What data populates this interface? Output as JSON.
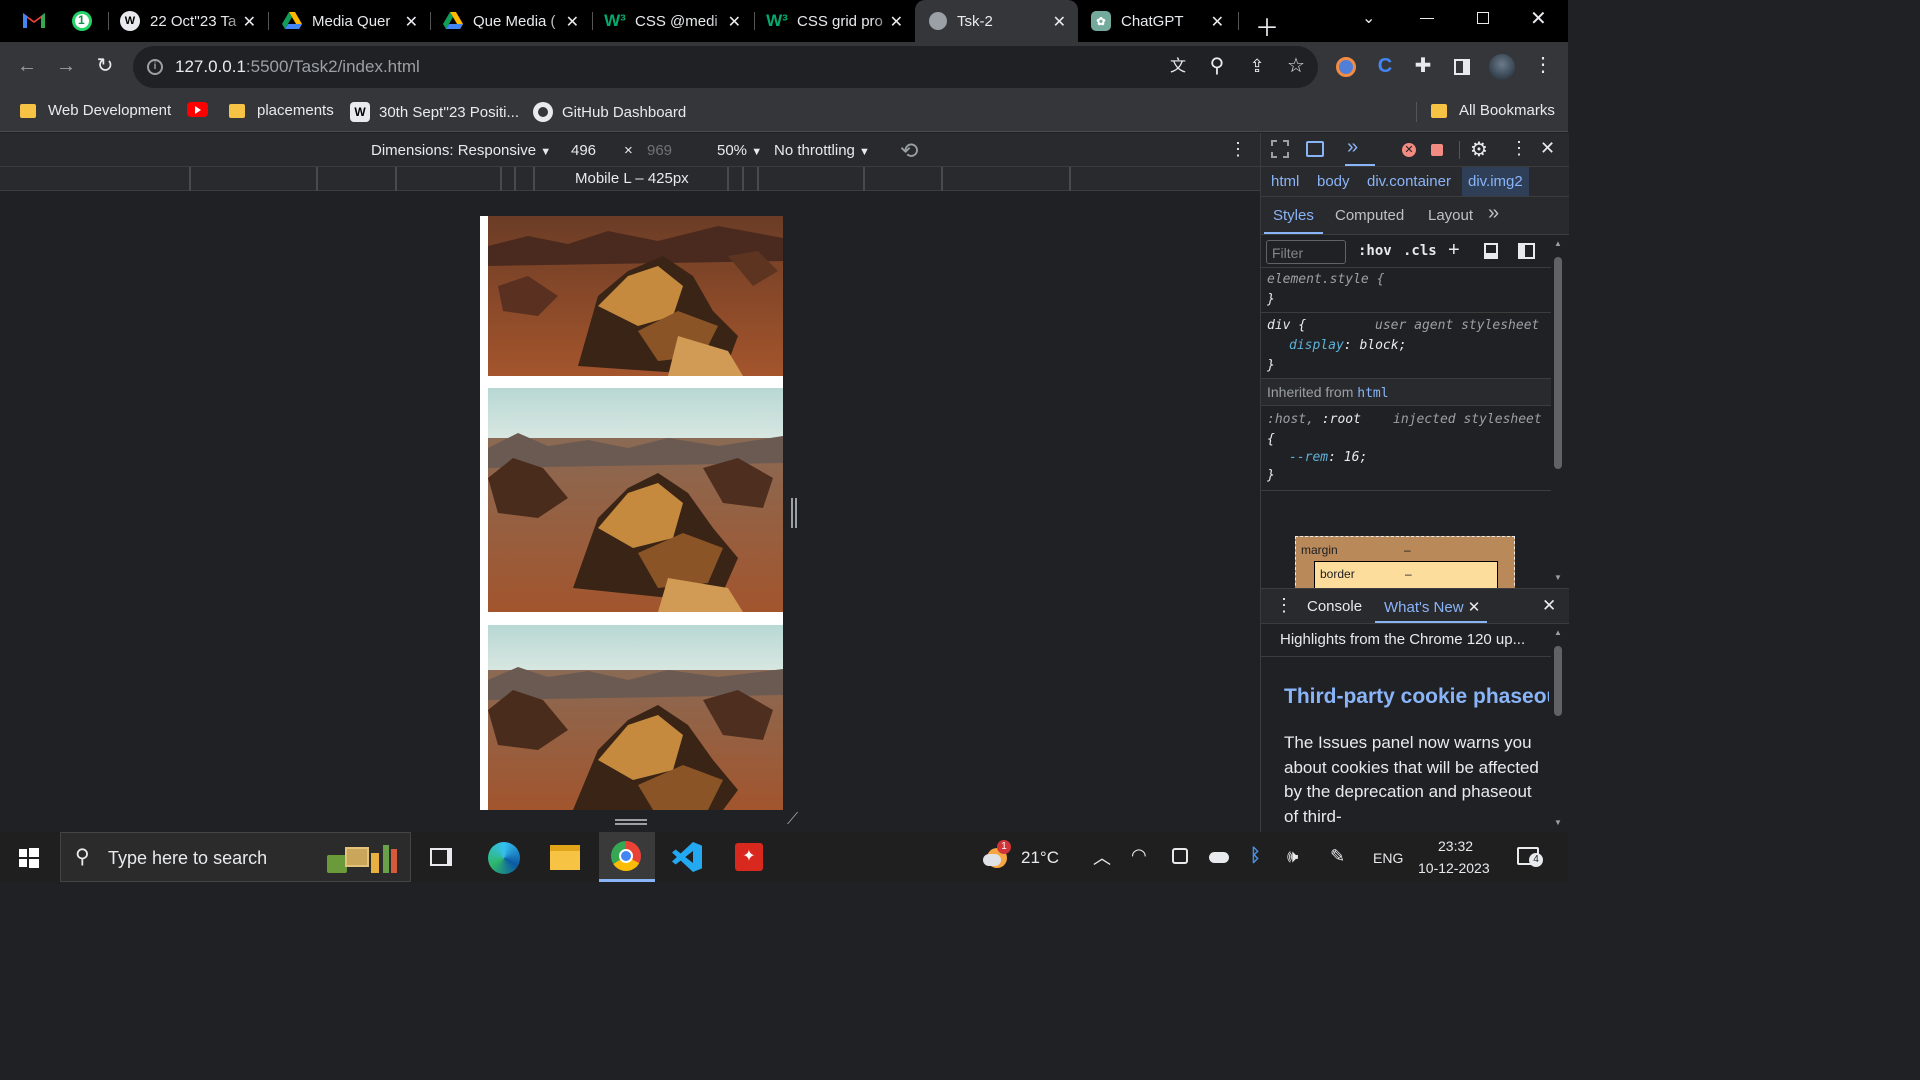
{
  "tabs": [
    {
      "title": "22 Oct''23 Ta",
      "icon": "wordpress-icon",
      "active": false
    },
    {
      "title": "Media Quer",
      "icon": "google-drive-icon",
      "active": false
    },
    {
      "title": "Que Media (",
      "icon": "google-drive-icon",
      "active": false
    },
    {
      "title": "CSS @medi",
      "icon": "w3schools-icon",
      "active": false
    },
    {
      "title": "CSS grid pro",
      "icon": "w3schools-icon",
      "active": false
    },
    {
      "title": "Tsk-2",
      "icon": "globe-icon",
      "active": true
    },
    {
      "title": "ChatGPT",
      "icon": "chatgpt-icon",
      "active": false
    }
  ],
  "pinned": [
    {
      "icon": "gmail-icon"
    },
    {
      "icon": "whatsapp-icon",
      "badge": "1"
    }
  ],
  "address": {
    "host": "127.0.0.1",
    "path": ":5500/Task2/index.html"
  },
  "bookmarks": [
    {
      "label": "Web Development",
      "icon": "folder-icon"
    },
    {
      "label": "",
      "icon": "youtube-icon"
    },
    {
      "label": "placements",
      "icon": "folder-icon"
    },
    {
      "label": "30th Sept''23 Positi...",
      "icon": "wordpress-icon"
    },
    {
      "label": "GitHub Dashboard",
      "icon": "github-icon"
    }
  ],
  "all_bookmarks": "All Bookmarks",
  "device_toolbar": {
    "dimensions": "Dimensions: Responsive",
    "width": "496",
    "times": "×",
    "height": "969",
    "zoom": "50%",
    "throttling": "No throttling",
    "media_query_label": "Mobile L – 425px"
  },
  "devtools": {
    "breadcrumbs": [
      "html",
      "body",
      "div.container",
      "div.img2"
    ],
    "subtabs": [
      "Styles",
      "Computed",
      "Layout"
    ],
    "filter_placeholder": "Filter",
    "hov": ":hov",
    "cls": ".cls",
    "element_style": "element.style {",
    "close_brace": "}",
    "div_selector": "div {",
    "ua_label": "user agent stylesheet",
    "display_prop": "display",
    "display_val": "block;",
    "inherited_label": "Inherited from",
    "inherited_from": "html",
    "host_selector": ":host,",
    "root_selector": ":root",
    "injected_label": "injected stylesheet",
    "open_brace": "{",
    "rem_prop": "--rem",
    "rem_val": "16;",
    "boxmodel_margin": "margin",
    "boxmodel_border": "border",
    "dash": "–",
    "drawer_tabs": [
      "Console",
      "What's New"
    ],
    "highlights": "Highlights from the Chrome 120 up...",
    "article_title": "Third-party cookie phaseout",
    "article_body": "The Issues panel now warns you about cookies that will be affected by the deprecation and phaseout of third-"
  },
  "taskbar": {
    "search_placeholder": "Type here to search",
    "weather": "21°C",
    "weather_badge": "1",
    "lang": "ENG",
    "time": "23:32",
    "date": "10-12-2023",
    "notifications": "4"
  }
}
